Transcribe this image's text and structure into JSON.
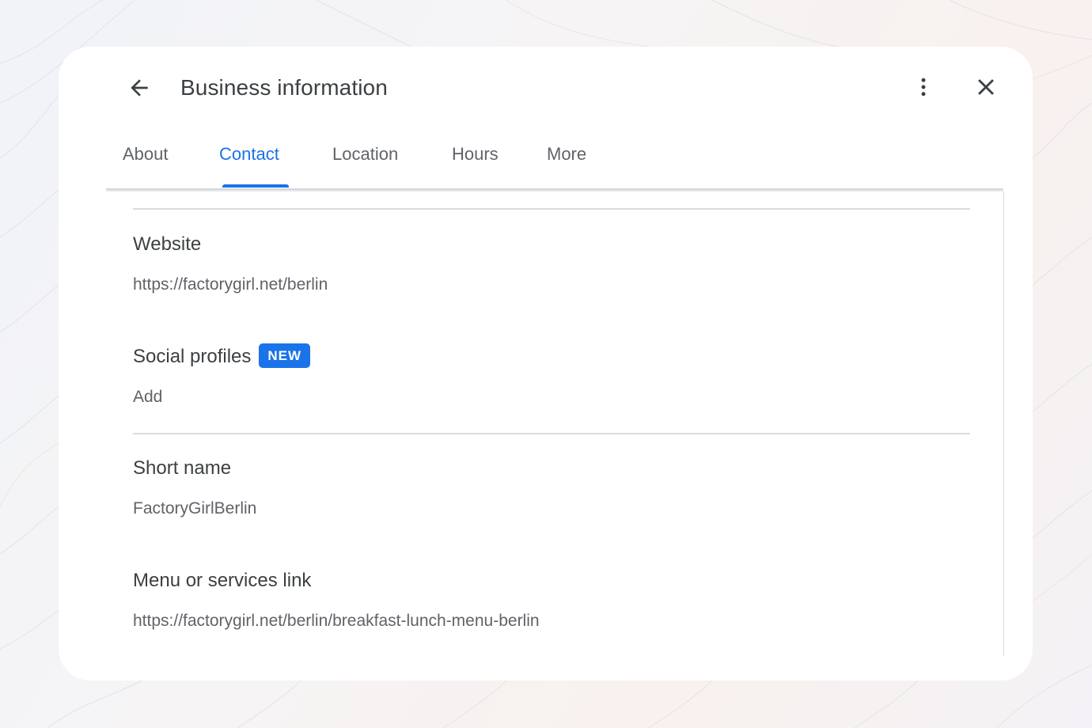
{
  "header": {
    "title": "Business information",
    "back_icon": "arrow-back-icon",
    "more_icon": "more-vert-icon",
    "close_icon": "close-icon"
  },
  "tabs": [
    {
      "label": "About",
      "active": false
    },
    {
      "label": "Contact",
      "active": true
    },
    {
      "label": "Location",
      "active": false
    },
    {
      "label": "Hours",
      "active": false
    },
    {
      "label": "More",
      "active": false
    }
  ],
  "fields": {
    "website": {
      "label": "Website",
      "value": "https://factorygirl.net/berlin"
    },
    "social_profiles": {
      "label": "Social profiles",
      "badge": "NEW",
      "value": "Add"
    },
    "short_name": {
      "label": "Short name",
      "value": "FactoryGirlBerlin"
    },
    "menu_link": {
      "label": "Menu or services link",
      "value": "https://factorygirl.net/berlin/breakfast-lunch-menu-berlin"
    }
  },
  "colors": {
    "accent": "#1a73e8",
    "text_primary": "#3c4043",
    "text_secondary": "#5f6368",
    "divider": "#dadce0"
  }
}
